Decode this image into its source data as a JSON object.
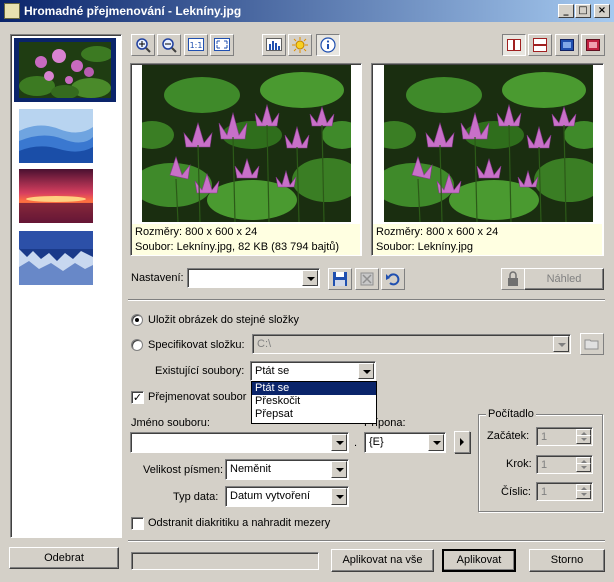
{
  "window": {
    "title": "Hromadné přejmenování - Lekníny.jpg",
    "controls": {
      "minimize": "_",
      "maximize": "□",
      "close": "×"
    }
  },
  "thumbnails": [
    "waterlily",
    "blue-hills",
    "sunset",
    "winter"
  ],
  "remove_label": "Odebrat",
  "toolbar": {
    "icons": [
      "zoom-in-icon",
      "zoom-out-icon",
      "actual-size-icon",
      "fit-window-icon",
      "histogram-icon",
      "adjust-icon",
      "info-icon"
    ],
    "view_icons": [
      "split-vertical-icon",
      "split-horizontal-icon",
      "view-single-icon",
      "view-result-icon"
    ]
  },
  "preview_left": {
    "dims": "Rozměry: 800 x 600 x 24",
    "file": "Soubor: Lekníny.jpg, 82 KB (83 794 bajtů)"
  },
  "preview_right": {
    "dims": "Rozměry: 800 x 600 x 24",
    "file": "Soubor: Lekníny.jpg"
  },
  "settings": {
    "label": "Nastavení:",
    "value": "",
    "preview_button": "Náhled"
  },
  "options": {
    "save_same": "Uložit obrázek do stejné složky",
    "specify_folder": "Specifikovat složku:",
    "folder_value": "C:\\",
    "existing_label": "Existující soubory:",
    "existing_value": "Ptát se",
    "existing_options": [
      "Ptát se",
      "Přeskočit",
      "Přepsat"
    ],
    "rename_files": "Přejmenovat soubor"
  },
  "filename": {
    "label": "Jméno souboru:",
    "value": "",
    "dot": ".",
    "ext_label": "Přípona:",
    "ext_value": "{E}"
  },
  "font_size": {
    "label": "Velikost písmen:",
    "value": "Neměnit"
  },
  "date_type": {
    "label": "Typ data:",
    "value": "Datum vytvoření"
  },
  "remove_diacritics": "Odstranit diakritiku a nahradit mezery",
  "counter": {
    "title": "Počítadlo",
    "start_label": "Začátek:",
    "start_value": "1",
    "step_label": "Krok:",
    "step_value": "1",
    "digits_label": "Číslic:",
    "digits_value": "1"
  },
  "buttons": {
    "apply_all": "Aplikovat na vše",
    "apply": "Aplikovat",
    "cancel": "Storno"
  }
}
